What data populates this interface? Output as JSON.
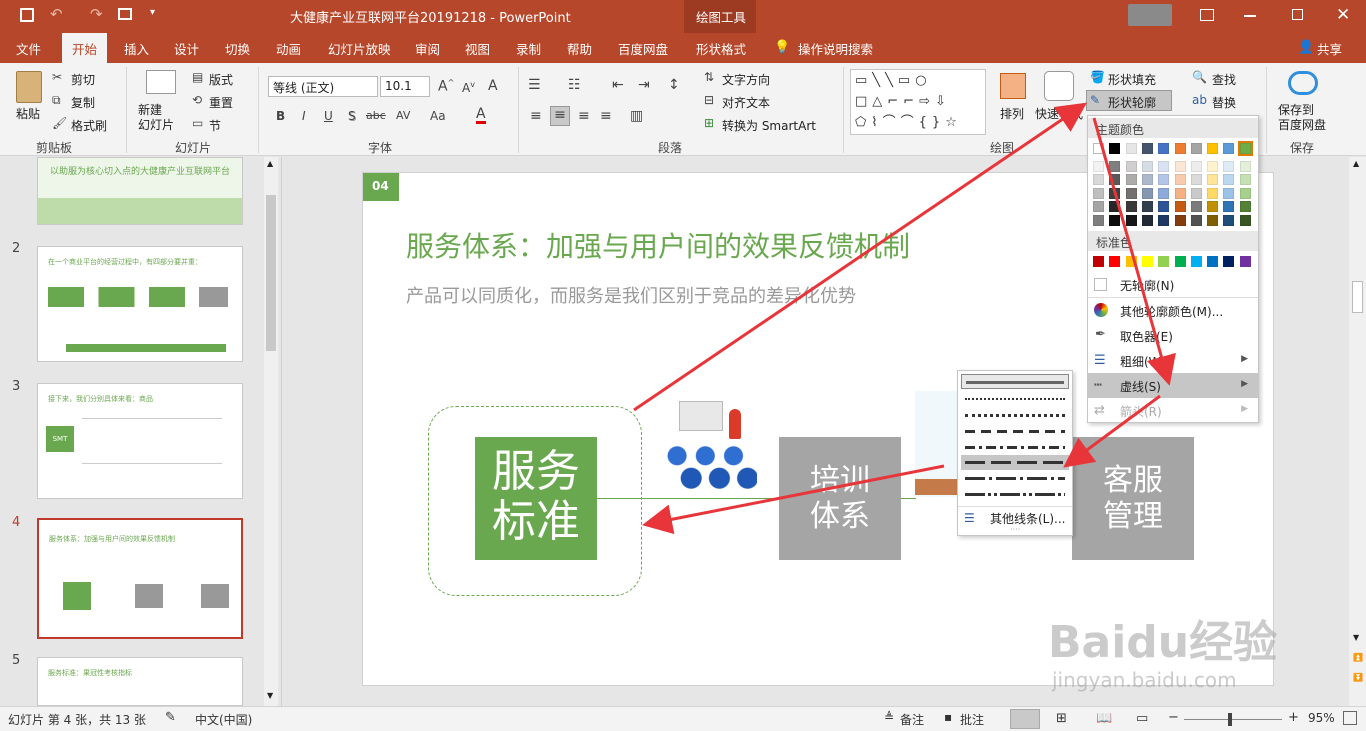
{
  "titlebar": {
    "title": "大健康产业互联网平台20191218  -  PowerPoint",
    "context_label": "绘图工具"
  },
  "tabs": [
    "文件",
    "开始",
    "插入",
    "设计",
    "切换",
    "动画",
    "幻灯片放映",
    "审阅",
    "视图",
    "录制",
    "帮助",
    "百度网盘",
    "形状格式"
  ],
  "active_tab": "开始",
  "tell_me": "操作说明搜索",
  "share": "共享",
  "ribbon": {
    "clipboard": {
      "paste": "粘贴",
      "cut": "剪切",
      "copy": "复制",
      "format_painter": "格式刷",
      "label": "剪贴板"
    },
    "slides": {
      "new_slide": "新建\n幻灯片",
      "layout": "版式",
      "reset": "重置",
      "section": "节",
      "label": "幻灯片"
    },
    "font": {
      "font_name": "等线 (正文)",
      "font_size": "10.1",
      "label": "字体",
      "bold": "B",
      "italic": "I",
      "underline": "U",
      "shadow": "S",
      "strike": "abc",
      "spacing": "AV",
      "case": "Aa",
      "color": "A"
    },
    "paragraph": {
      "text_direction": "文字方向",
      "align_text": "对齐文本",
      "smartart": "转换为 SmartArt",
      "label": "段落"
    },
    "drawing": {
      "arrange": "排列",
      "quick_styles": "快速样式",
      "shape_fill": "形状填充",
      "shape_outline": "形状轮廓",
      "label": "绘图"
    },
    "editing": {
      "find": "查找",
      "replace": "替换"
    },
    "save": {
      "save_baidu": "保存到\n百度网盘",
      "label": "保存"
    }
  },
  "thumbnails": [
    {
      "num": "",
      "title": "以助服为核心切入点的大健康产业互联网平台"
    },
    {
      "num": "2",
      "title": "在一个商业平台的经营过程中，有四部分要并重："
    },
    {
      "num": "3",
      "title": "接下来，我们分别具体来看：商品"
    },
    {
      "num": "4",
      "title": "服务体系：加强与用户间的效果反馈机制"
    },
    {
      "num": "5",
      "title": "服务标准：果冠性考核指标"
    }
  ],
  "slide": {
    "badge": "04",
    "title": "服务体系：加强与用户间的效果反馈机制",
    "subtitle": "产品可以同质化，而服务是我们区别于竞品的差异化优势",
    "box1": "服务\n标准",
    "box2": "培训\n体系",
    "box3": "客服\n管理"
  },
  "outline_menu": {
    "theme_colors": "主题颜色",
    "standard_colors": "标准色",
    "no_outline": "无轮廓(N)",
    "more_colors": "其他轮廓颜色(M)...",
    "eyedropper": "取色器(E)",
    "weight": "粗细(W)",
    "dashes": "虚线(S)",
    "arrows": "箭头(R)"
  },
  "dash_menu": {
    "more_lines": "其他线条(L)..."
  },
  "theme_color_grid": [
    [
      "#ffffff",
      "#000000",
      "#e7e6e6",
      "#44546a",
      "#4472c4",
      "#ed7d31",
      "#a5a5a5",
      "#ffc000",
      "#5b9bd5",
      "#70ad47"
    ],
    [
      "#f2f2f2",
      "#7f7f7f",
      "#d0cece",
      "#d6dce4",
      "#d9e2f3",
      "#fbe5d5",
      "#ededed",
      "#fff2cc",
      "#deebf6",
      "#e2efd9"
    ],
    [
      "#d8d8d8",
      "#595959",
      "#aeabab",
      "#adb9ca",
      "#b4c6e7",
      "#f7cbac",
      "#dbdbdb",
      "#fee599",
      "#bdd7ee",
      "#c5e0b3"
    ],
    [
      "#bfbfbf",
      "#3f3f3f",
      "#757070",
      "#8496b0",
      "#8eaadb",
      "#f4b183",
      "#c9c9c9",
      "#ffd965",
      "#9cc3e5",
      "#a8d08d"
    ],
    [
      "#a5a5a5",
      "#262626",
      "#3a3838",
      "#323f4f",
      "#2f5496",
      "#c55a11",
      "#7b7b7b",
      "#bf9000",
      "#2e75b5",
      "#538135"
    ],
    [
      "#7f7f7f",
      "#0c0c0c",
      "#171616",
      "#222a35",
      "#1f3864",
      "#833c0b",
      "#525252",
      "#7f6000",
      "#1e4e79",
      "#375623"
    ]
  ],
  "standard_color_row": [
    "#c00000",
    "#ff0000",
    "#ffc000",
    "#ffff00",
    "#92d050",
    "#00b050",
    "#00b0f0",
    "#0070c0",
    "#002060",
    "#7030a0"
  ],
  "status": {
    "slide_info": "幻灯片 第 4 张，共 13 张",
    "language": "中文(中国)",
    "notes": "备注",
    "comments": "批注",
    "zoom": "95%"
  },
  "watermark": {
    "brand": "Baidu经验",
    "url": "jingyan.baidu.com"
  }
}
